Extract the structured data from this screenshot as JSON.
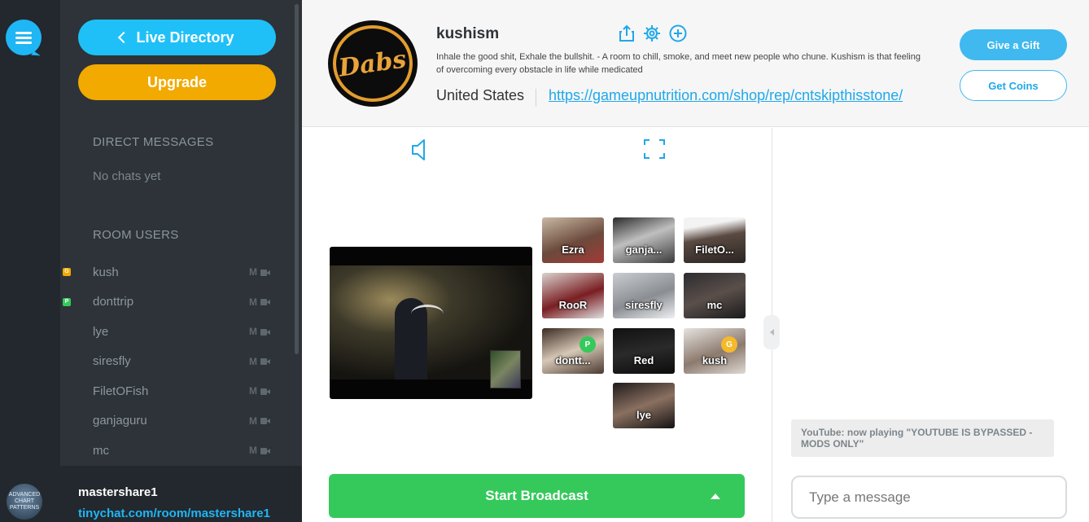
{
  "sidebar": {
    "live_directory": "Live Directory",
    "upgrade": "Upgrade",
    "direct_messages_title": "DIRECT MESSAGES",
    "no_chats": "No chats yet",
    "room_users_title": "ROOM USERS",
    "users": [
      {
        "name": "kush",
        "badge": "G",
        "badge_color": "#f2a900"
      },
      {
        "name": "donttrip",
        "badge": "P",
        "badge_color": "#35c95b"
      },
      {
        "name": "lye",
        "badge": "",
        "badge_color": ""
      },
      {
        "name": "siresfly",
        "badge": "",
        "badge_color": ""
      },
      {
        "name": "FiletOFish",
        "badge": "",
        "badge_color": ""
      },
      {
        "name": "ganjaguru",
        "badge": "",
        "badge_color": ""
      },
      {
        "name": "mc",
        "badge": "",
        "badge_color": ""
      }
    ],
    "mic_icon_label": "M",
    "me": {
      "name": "mastershare1",
      "link": "tinychat.com/room/mastershare1",
      "avatar_text": "ADVANCED CHART PATTERNS"
    }
  },
  "header": {
    "room_name": "kushism",
    "description": "Inhale the good shit, Exhale the bullshit. - A room to chill, smoke, and meet new people who chune. Kushism is that feeling of overcoming every obstacle in life while medicated",
    "country": "United States",
    "link": "https://gameupnutrition.com/shop/rep/cntskipthisstone/",
    "avatar_text": "Dabs",
    "give_gift": "Give a Gift",
    "get_coins": "Get Coins"
  },
  "videos": {
    "tiles": [
      {
        "label": "Ezra",
        "bg": "linear-gradient(160deg,#c8b8a4,#6b4a3c 55%,#a33a36)",
        "badge": "",
        "badge_color": ""
      },
      {
        "label": "ganja...",
        "bg": "linear-gradient(160deg,#2b2b2b,#bfbfbf 45%,#3a3a3a)",
        "badge": "",
        "badge_color": ""
      },
      {
        "label": "FiletO...",
        "bg": "linear-gradient(170deg,#f3f3f3 20%,#5a4a42 45%,#2a2522)",
        "badge": "",
        "badge_color": ""
      },
      {
        "label": "RooR",
        "bg": "linear-gradient(160deg,#d9d2cd,#7a1e22 55%,#e0e0e0)",
        "badge": "",
        "badge_color": ""
      },
      {
        "label": "siresfly",
        "bg": "linear-gradient(160deg,#c9ccd0,#8a8e93 55%,#eef0f2)",
        "badge": "",
        "badge_color": ""
      },
      {
        "label": "mc",
        "bg": "linear-gradient(160deg,#2c2c30,#5a4f4a 50%,#1a1a1c)",
        "badge": "",
        "badge_color": ""
      },
      {
        "label": "dontt...",
        "bg": "linear-gradient(160deg,#3a2a22,#d7c7b6 50%,#4a3a30)",
        "badge": "P",
        "badge_color": "#35c95b"
      },
      {
        "label": "Red",
        "bg": "linear-gradient(170deg,#111,#2a2a2a 50%,#0c0c0c)",
        "badge": "",
        "badge_color": ""
      },
      {
        "label": "kush",
        "bg": "linear-gradient(160deg,#e6e3df,#8c7a6e 55%,#ded9d3)",
        "badge": "G",
        "badge_color": "#f5b92a"
      },
      {
        "label": "lye",
        "bg": "linear-gradient(160deg,#1f1b1a,#8a7060 50%,#141212)",
        "badge": "",
        "badge_color": ""
      }
    ],
    "start_broadcast": "Start Broadcast"
  },
  "chat": {
    "youtube_message": "YouTube: now playing \"YOUTUBE IS BYPASSED - MODS ONLY\"",
    "input_placeholder": "Type a message"
  }
}
